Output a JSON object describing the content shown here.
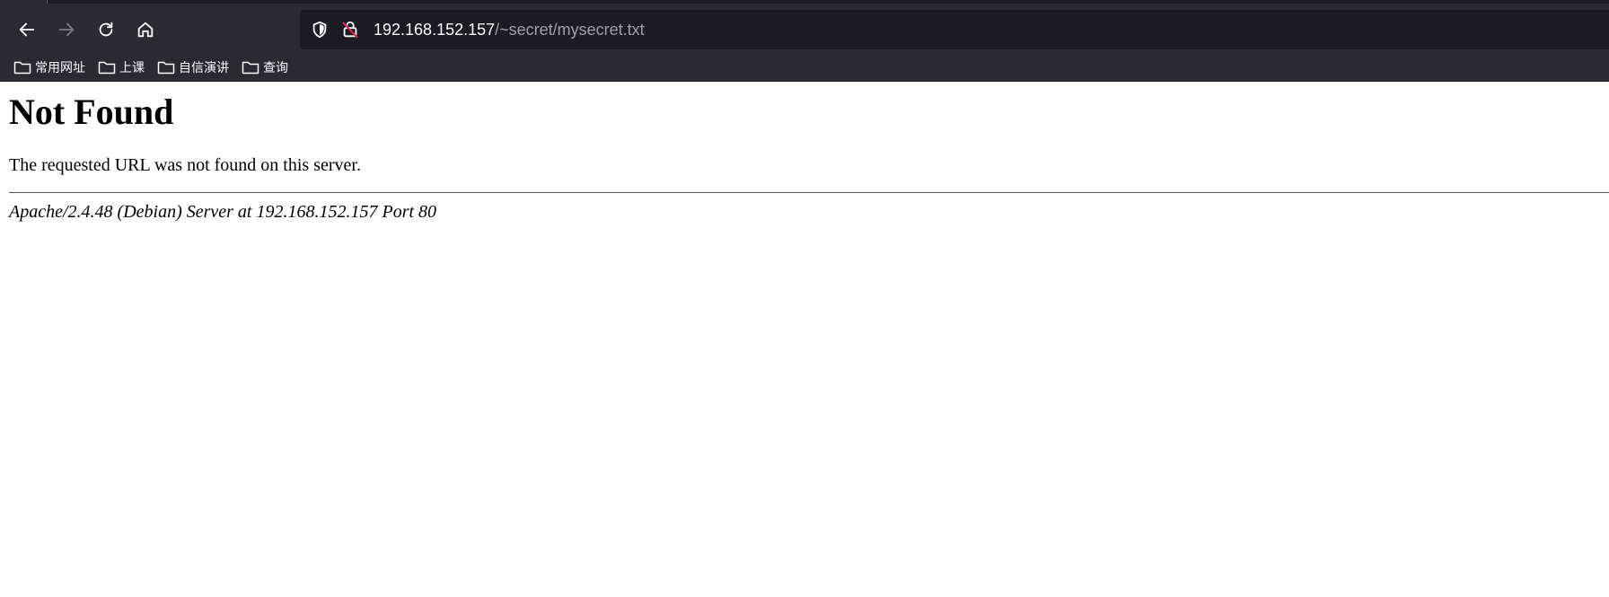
{
  "browser": {
    "nav": {
      "back_icon": "arrow-left-icon",
      "forward_icon": "arrow-right-icon",
      "reload_icon": "reload-icon",
      "home_icon": "home-icon"
    },
    "urlbar": {
      "host": "192.168.152.157",
      "path": "/~secret/mysecret.txt",
      "shield_icon": "tracking-shield-icon",
      "lock_icon": "insecure-lock-icon"
    },
    "bookmarks": [
      {
        "label": "常用网址",
        "icon": "folder-icon"
      },
      {
        "label": "上课",
        "icon": "folder-icon"
      },
      {
        "label": "自信演讲",
        "icon": "folder-icon"
      },
      {
        "label": "查询",
        "icon": "folder-icon"
      }
    ],
    "colors": {
      "chrome_bg": "#2b2a33",
      "urlbar_bg": "#1c1b22",
      "text_light": "#fbfbfe",
      "path_gray": "#a1a0a8",
      "lock_slash_red": "#e22850"
    }
  },
  "page": {
    "heading": "Not Found",
    "message": "The requested URL was not found on this server.",
    "signature": "Apache/2.4.48 (Debian) Server at 192.168.152.157 Port 80"
  }
}
